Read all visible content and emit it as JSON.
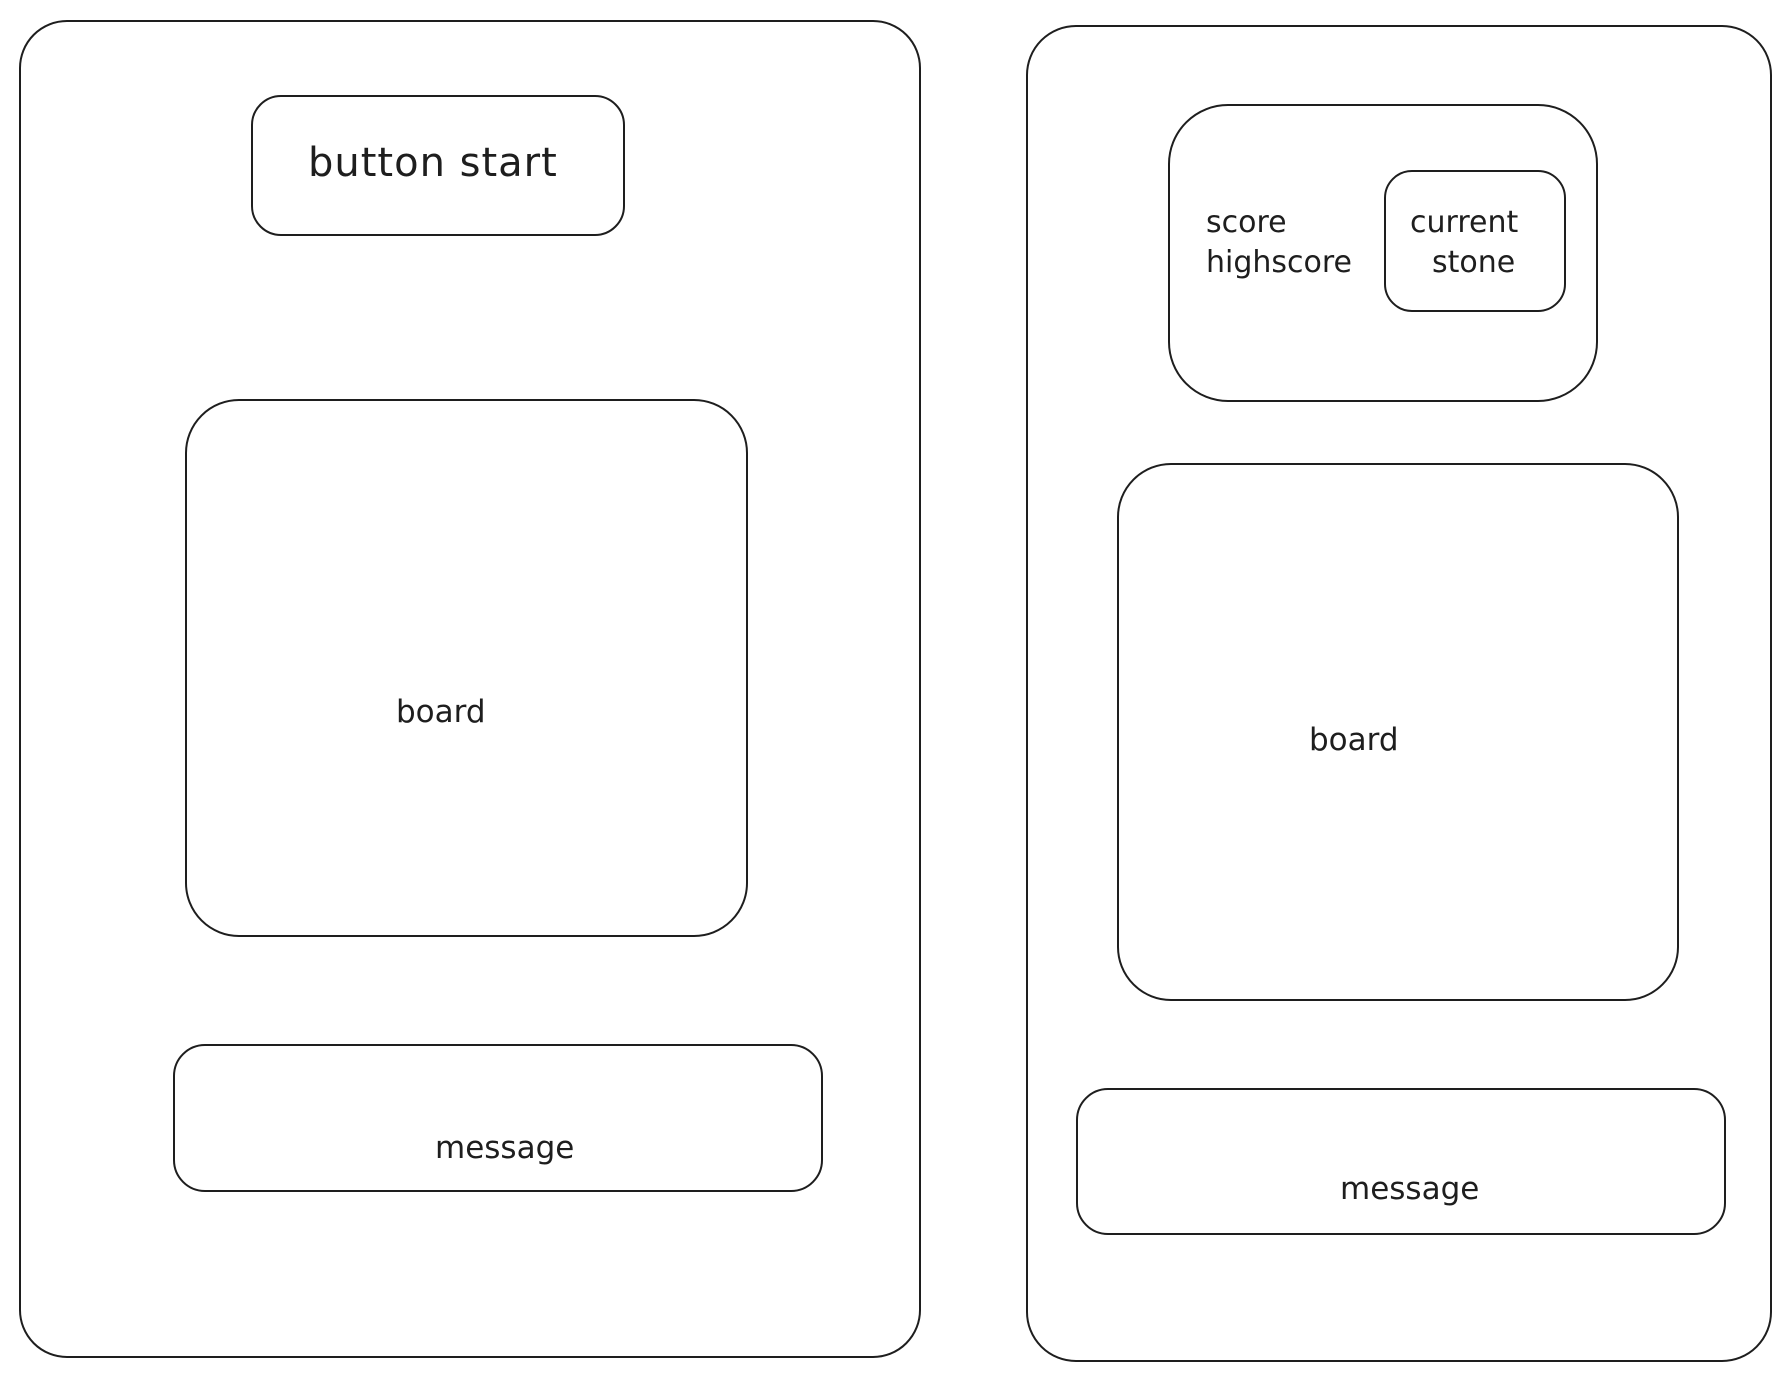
{
  "screens": [
    {
      "start_button": {
        "label": "button start"
      },
      "board": {
        "label": "board"
      },
      "message": {
        "label": "message"
      }
    },
    {
      "score_panel": {
        "score_label": "score",
        "highscore_label": "highscore",
        "current_stone": {
          "line1": "current",
          "line2": "stone"
        }
      },
      "board": {
        "label": "board"
      },
      "message": {
        "label": "message"
      }
    }
  ],
  "colors": {
    "stroke": "#1e1e1e",
    "background": "#ffffff"
  }
}
